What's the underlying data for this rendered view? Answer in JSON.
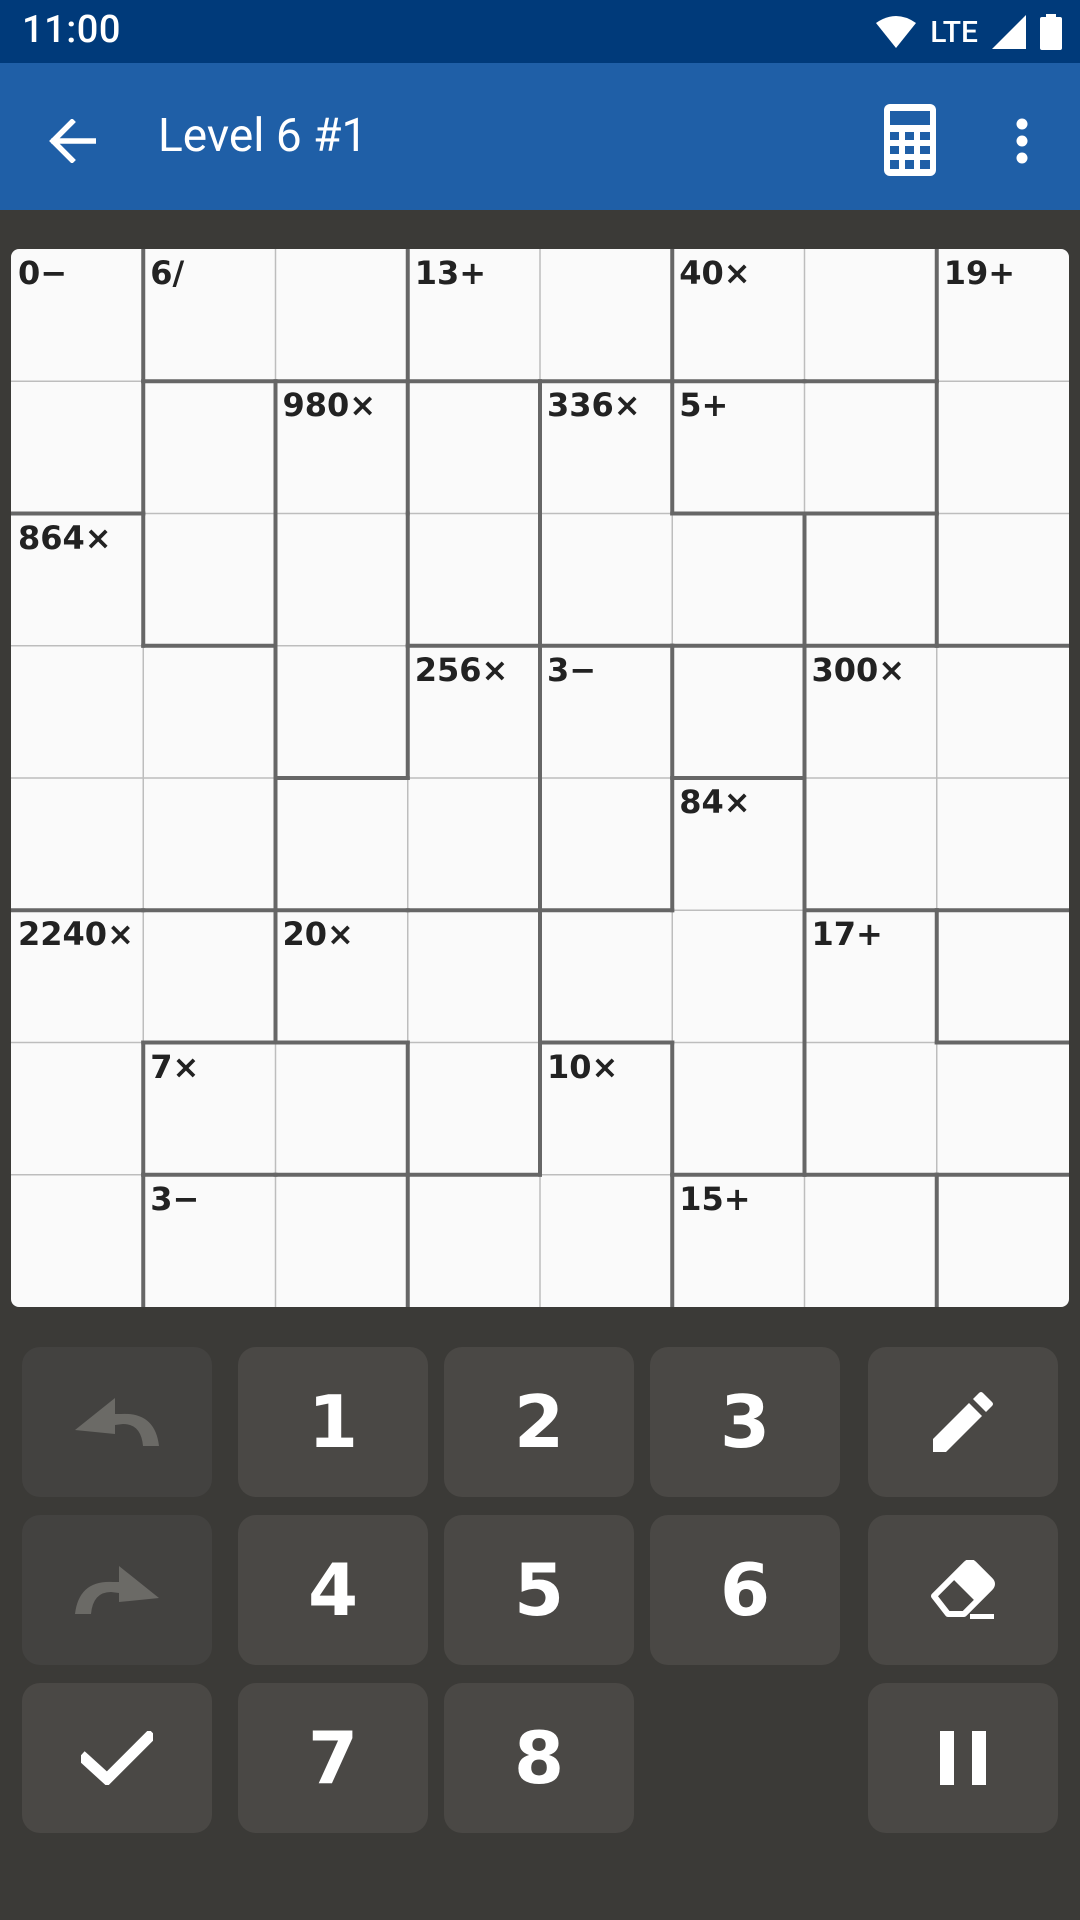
{
  "status_bar": {
    "time": "11:00",
    "network": "LTE",
    "icons": [
      "wifi-icon",
      "signal-icon",
      "battery-icon"
    ]
  },
  "app_bar": {
    "title": "Level 6 #1",
    "icons": [
      "back-arrow-icon",
      "calculator-icon",
      "more-vert-icon"
    ]
  },
  "board": {
    "size": 8,
    "cages": [
      {
        "clue": "0−",
        "cells": [
          [
            0,
            0
          ],
          [
            1,
            0
          ]
        ]
      },
      {
        "clue": "6/",
        "cells": [
          [
            0,
            1
          ],
          [
            0,
            2
          ]
        ]
      },
      {
        "clue": "13+",
        "cells": [
          [
            0,
            3
          ],
          [
            0,
            4
          ],
          [
            1,
            4
          ]
        ]
      },
      {
        "clue": "40×",
        "cells": [
          [
            0,
            5
          ],
          [
            0,
            6
          ]
        ]
      },
      {
        "clue": "19+",
        "cells": [
          [
            0,
            7
          ],
          [
            1,
            7
          ],
          [
            2,
            7
          ]
        ]
      },
      {
        "clue": "980×",
        "cells": [
          [
            1,
            2
          ],
          [
            2,
            2
          ],
          [
            3,
            2
          ]
        ]
      },
      {
        "clue": "336×",
        "cells": [
          [
            1,
            4
          ],
          [
            2,
            4
          ],
          [
            2,
            5
          ]
        ]
      },
      {
        "clue": "5+",
        "cells": [
          [
            1,
            5
          ],
          [
            1,
            6
          ]
        ]
      },
      {
        "clue": "864×",
        "cells": [
          [
            2,
            0
          ],
          [
            3,
            0
          ],
          [
            3,
            1
          ],
          [
            4,
            0
          ],
          [
            4,
            1
          ]
        ]
      },
      {
        "clue": "256×",
        "cells": [
          [
            3,
            3
          ],
          [
            4,
            3
          ],
          [
            4,
            2
          ]
        ]
      },
      {
        "clue": "3−",
        "cells": [
          [
            3,
            4
          ],
          [
            4,
            4
          ]
        ]
      },
      {
        "clue": "300×",
        "cells": [
          [
            3,
            6
          ],
          [
            4,
            6
          ],
          [
            3,
            7
          ],
          [
            4,
            7
          ]
        ]
      },
      {
        "clue": "84×",
        "cells": [
          [
            4,
            5
          ],
          [
            5,
            5
          ],
          [
            5,
            4
          ],
          [
            6,
            5
          ]
        ]
      },
      {
        "clue": "2240×",
        "cells": [
          [
            5,
            0
          ],
          [
            5,
            1
          ],
          [
            6,
            0
          ],
          [
            7,
            0
          ]
        ]
      },
      {
        "clue": "20×",
        "cells": [
          [
            5,
            2
          ],
          [
            5,
            3
          ],
          [
            6,
            3
          ]
        ]
      },
      {
        "clue": "17+",
        "cells": [
          [
            5,
            6
          ],
          [
            6,
            6
          ],
          [
            6,
            7
          ]
        ]
      },
      {
        "clue": "7×",
        "cells": [
          [
            6,
            1
          ],
          [
            6,
            2
          ]
        ]
      },
      {
        "clue": "10×",
        "cells": [
          [
            6,
            4
          ],
          [
            7,
            3
          ],
          [
            7,
            4
          ]
        ]
      },
      {
        "clue": "3−",
        "cells": [
          [
            7,
            1
          ],
          [
            7,
            2
          ]
        ]
      },
      {
        "clue": "15+",
        "cells": [
          [
            7,
            5
          ],
          [
            7,
            6
          ]
        ]
      }
    ]
  },
  "keypad": {
    "undo_icon": "undo-icon",
    "redo_icon": "redo-icon",
    "check_icon": "check-icon",
    "pencil_icon": "pencil-icon",
    "eraser_icon": "eraser-icon",
    "pause_icon": "pause-icon",
    "digits": [
      "1",
      "2",
      "3",
      "4",
      "5",
      "6",
      "7",
      "8"
    ]
  },
  "colors": {
    "status_bar": "#003a7a",
    "app_bar": "#1f5fa7",
    "background": "#3b3a37",
    "board": "#fafafa",
    "key": "#4a4845"
  }
}
